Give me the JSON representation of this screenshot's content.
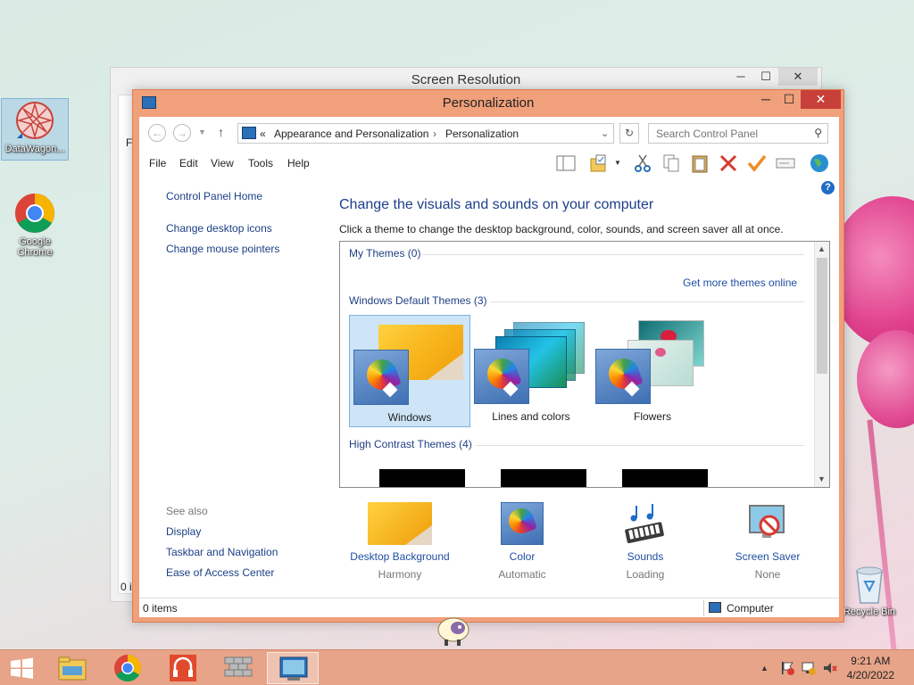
{
  "desktop": {
    "icons": [
      {
        "label": "DataWagon...",
        "icon": "datawagon-icon"
      },
      {
        "label": "Google Chrome",
        "icon": "chrome-icon"
      },
      {
        "label": "Recycle Bin",
        "icon": "recycle-bin-icon"
      }
    ]
  },
  "back_window": {
    "title": "Screen Resolution",
    "left_text_1": "Fi",
    "left_text_2": "0 it"
  },
  "window": {
    "title": "Personalization",
    "controls": {
      "minimize": "─",
      "maximize": "☐",
      "close": "✕"
    },
    "address": {
      "prefix": "«",
      "crumbs": [
        "Appearance and Personalization",
        "Personalization"
      ],
      "sep": "›"
    },
    "search": {
      "placeholder": "Search Control Panel"
    },
    "menu": [
      "File",
      "Edit",
      "View",
      "Tools",
      "Help"
    ],
    "left_pane": {
      "links": [
        "Control Panel Home",
        "Change desktop icons",
        "Change mouse pointers"
      ],
      "see_also_heading": "See also",
      "see_also": [
        "Display",
        "Taskbar and Navigation",
        "Ease of Access Center"
      ]
    },
    "main": {
      "title": "Change the visuals and sounds on your computer",
      "subtitle": "Click a theme to change the desktop background, color, sounds, and screen saver all at once.",
      "sections": {
        "my_themes": "My Themes (0)",
        "get_more": "Get more themes online",
        "default_themes": "Windows Default Themes (3)",
        "high_contrast": "High Contrast Themes (4)"
      },
      "themes": [
        {
          "name": "Windows",
          "selected": true
        },
        {
          "name": "Lines and colors",
          "selected": false
        },
        {
          "name": "Flowers",
          "selected": false
        }
      ],
      "bottom": [
        {
          "name": "Desktop Background",
          "value": "Harmony",
          "icon": "desktop-background-icon"
        },
        {
          "name": "Color",
          "value": "Automatic",
          "icon": "color-icon"
        },
        {
          "name": "Sounds",
          "value": "Loading",
          "icon": "sounds-icon"
        },
        {
          "name": "Screen Saver",
          "value": "None",
          "icon": "screen-saver-icon"
        }
      ]
    },
    "status": {
      "items": "0 items",
      "location": "Computer"
    }
  },
  "taskbar": {
    "time": "9:21 AM",
    "date": "4/20/2022",
    "tray_arrow": "▲"
  },
  "colors": {
    "accent": "#f0a07a",
    "link": "#1e3f8a",
    "taskbar": "#e7a488",
    "close": "#c7403a"
  }
}
